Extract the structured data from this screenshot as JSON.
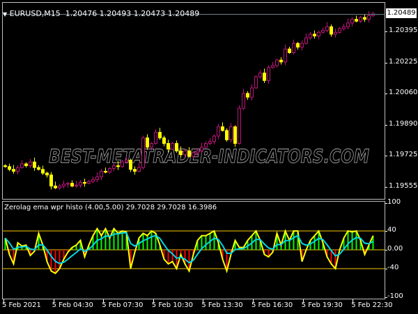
{
  "main_chart": {
    "symbol_label": "EURUSD,M15",
    "ohlc_header": "1.20476 1.20493 1.20473 1.20489",
    "current_price": "1.20489",
    "price_axis": [
      "1.20395",
      "1.20225",
      "1.20060",
      "1.19890",
      "1.19725",
      "1.19555"
    ],
    "watermark": "BEST-METATRADER-INDICATORS.COM",
    "colors": {
      "bull": "#c0147c",
      "bear": "#ffff00",
      "grid": "#c0c0c0"
    }
  },
  "indicator": {
    "title": "Zerolag ema wpr histo (4.00,5.00) 29.7028 29.7028 16.3986",
    "axis": [
      "100",
      "40",
      "0.00",
      "-40",
      "-100"
    ],
    "colors": {
      "fast": "#ffff00",
      "slow": "#00d8e8",
      "up": "#00ff00",
      "down": "#ff0000",
      "level": "#c8a000"
    }
  },
  "time_axis": [
    "5 Feb 2021",
    "5 Feb 04:30",
    "5 Feb 07:30",
    "5 Feb 10:30",
    "5 Feb 13:30",
    "5 Feb 16:30",
    "5 Feb 19:30",
    "5 Feb 22:30"
  ],
  "chart_data": [
    {
      "type": "candlestick",
      "title": "EURUSD,M15",
      "ylim": [
        1.195,
        1.2056
      ],
      "close": [
        1.19665,
        1.1965,
        1.1964,
        1.1966,
        1.1968,
        1.1967,
        1.1969,
        1.1966,
        1.1965,
        1.1963,
        1.1962,
        1.1956,
        1.1955,
        1.1956,
        1.1957,
        1.19575,
        1.1956,
        1.19565,
        1.1958,
        1.19575,
        1.19585,
        1.19595,
        1.1961,
        1.1964,
        1.19635,
        1.19655,
        1.1967,
        1.19665,
        1.1969,
        1.197,
        1.1965,
        1.1964,
        1.1966,
        1.1982,
        1.1977,
        1.1979,
        1.1985,
        1.1982,
        1.1979,
        1.1976,
        1.1979,
        1.1975,
        1.1973,
        1.1975,
        1.1972,
        1.1974,
        1.1975,
        1.1977,
        1.1979,
        1.198,
        1.1983,
        1.1988,
        1.1986,
        1.1981,
        1.1988,
        1.1979,
        1.1998,
        1.2006,
        1.2004,
        1.2009,
        1.2015,
        1.2017,
        1.2013,
        1.202,
        1.2021,
        1.2024,
        1.2023,
        1.203,
        1.2028,
        1.2033,
        1.2031,
        1.2033,
        1.2036,
        1.2038,
        1.2037,
        1.2039,
        1.204,
        1.2042,
        1.2038,
        1.2039,
        1.2041,
        1.2042,
        1.2044,
        1.2046,
        1.2045,
        1.2047,
        1.2046,
        1.2048,
        1.20489
      ]
    },
    {
      "type": "line",
      "title": "Zerolag ema wpr histo",
      "ylim": [
        -110,
        110
      ],
      "levels": [
        40,
        0,
        -40
      ],
      "fast": [
        25,
        -10,
        -30,
        15,
        8,
        10,
        -12,
        -3,
        35,
        10,
        -25,
        -45,
        -50,
        -40,
        -20,
        -5,
        5,
        10,
        20,
        -15,
        10,
        30,
        45,
        30,
        45,
        25,
        45,
        35,
        40,
        38,
        -40,
        -5,
        25,
        35,
        30,
        40,
        35,
        10,
        -20,
        -30,
        -25,
        -40,
        -10,
        -30,
        -45,
        -10,
        20,
        30,
        30,
        35,
        40,
        15,
        -20,
        -45,
        -10,
        20,
        5,
        5,
        20,
        30,
        40,
        20,
        -10,
        -15,
        -5,
        35,
        10,
        40,
        20,
        40,
        40,
        -25,
        0,
        20,
        30,
        40,
        15,
        -15,
        -30,
        -40,
        0,
        25,
        40,
        38,
        40,
        20,
        -10,
        10,
        30
      ]
    }
  ]
}
